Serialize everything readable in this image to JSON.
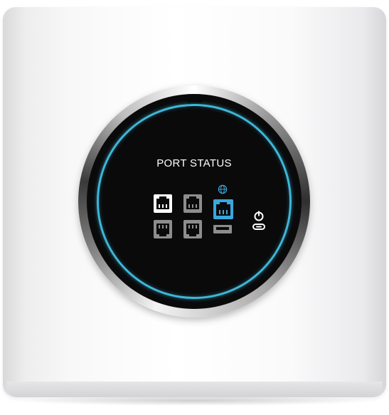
{
  "screen": {
    "title": "PORT STATUS"
  },
  "ports": [
    {
      "name": "lan-port-1",
      "state": "active",
      "color": "#ffffff"
    },
    {
      "name": "lan-port-2",
      "state": "inactive",
      "color": "#8d8d8d"
    },
    {
      "name": "lan-port-3",
      "state": "inactive",
      "color": "#8d8d8d"
    },
    {
      "name": "lan-port-4",
      "state": "inactive",
      "color": "#8d8d8d"
    },
    {
      "name": "wan-port",
      "state": "active",
      "color": "#3aa6dd"
    }
  ],
  "icons": {
    "wan": "globe-icon",
    "usb": "usb-port-icon",
    "power": "power-icon"
  },
  "colors": {
    "accent_ring": "#3fb6d6",
    "wan_blue": "#3aa6dd",
    "inactive_gray": "#8d8d8d"
  }
}
